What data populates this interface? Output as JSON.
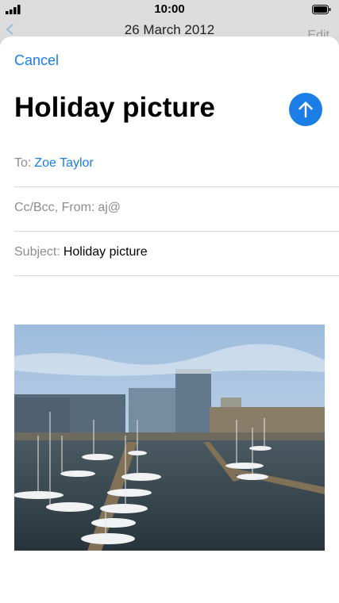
{
  "status_bar": {
    "time": "10:00"
  },
  "background_screen": {
    "title": "26 March 2012",
    "edit_label": "Edit"
  },
  "compose": {
    "cancel_label": "Cancel",
    "title": "Holiday picture",
    "to_label": "To:",
    "to_value": "Zoe Taylor",
    "cc_label": "Cc/Bcc, From:",
    "cc_value": "aj@",
    "subject_label": "Subject:",
    "subject_value": "Holiday picture"
  },
  "colors": {
    "accent": "#1a7ee6"
  },
  "icons": {
    "send": "arrow-up-icon"
  }
}
